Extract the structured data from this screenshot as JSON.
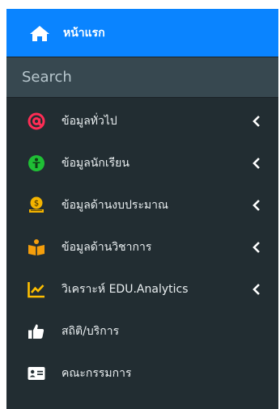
{
  "colors": {
    "sidebar_bg": "#222d32",
    "home_bg": "#0a84ff",
    "search_bg": "#374850",
    "text": "#e9eef0",
    "icon_at": "#ff2d55",
    "icon_student": "#1fbf35",
    "icon_budget": "#f4b400",
    "icon_academic": "#f59e0b",
    "icon_analytics": "#ffbf00",
    "icon_white": "#ffffff"
  },
  "sidebar": {
    "home": {
      "label": "หน้าแรก",
      "icon": "home-icon"
    },
    "search": {
      "placeholder": "Search",
      "value": ""
    },
    "items": [
      {
        "label": "ข้อมูลทั่วไป",
        "icon": "at-icon",
        "has_chevron": true
      },
      {
        "label": "ข้อมูลนักเรียน",
        "icon": "student-icon",
        "has_chevron": true
      },
      {
        "label": "ข้อมูลด้านงบประมาณ",
        "icon": "budget-icon",
        "has_chevron": true
      },
      {
        "label": "ข้อมูลด้านวิชาการ",
        "icon": "academic-icon",
        "has_chevron": true
      },
      {
        "label": "วิเคราะห์ EDU.Analytics",
        "icon": "analytics-icon",
        "has_chevron": true
      },
      {
        "label": "สถิติ/บริการ",
        "icon": "thumbs-up-icon",
        "has_chevron": false
      },
      {
        "label": "คณะกรรมการ",
        "icon": "id-card-icon",
        "has_chevron": false
      }
    ]
  }
}
